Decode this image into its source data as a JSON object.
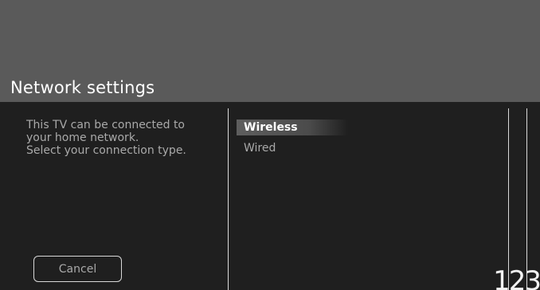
{
  "header": {
    "title": "Network settings"
  },
  "description": {
    "lines": [
      "This TV can be connected to",
      "your home network.",
      "Select your connection type."
    ]
  },
  "menu": {
    "items": [
      {
        "label": "Wireless",
        "selected": true
      },
      {
        "label": "Wired",
        "selected": false
      }
    ]
  },
  "buttons": {
    "cancel_label": "Cancel"
  },
  "page_indicator": "123",
  "colors": {
    "header_bg": "#5a5a5a",
    "content_bg": "#1f1f1f",
    "text_primary": "#ffffff",
    "text_secondary": "#a9a9a9"
  }
}
